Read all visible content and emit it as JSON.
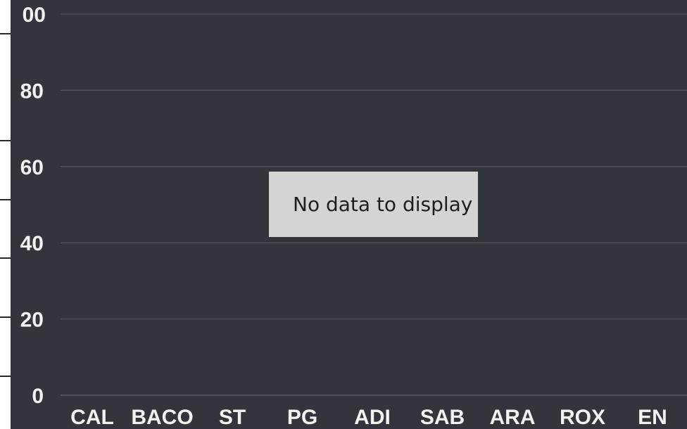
{
  "chart_data": {
    "type": "bar",
    "categories": [
      "CAL",
      "BACO",
      "ST",
      "PG",
      "ADI",
      "SAB",
      "ARA",
      "ROX",
      "EN"
    ],
    "series": [],
    "yticks": [
      "00",
      "80",
      "60",
      "40",
      "20",
      "0"
    ],
    "ylim": [
      0,
      100
    ],
    "grid": true,
    "title": "",
    "xlabel": "",
    "ylabel": ""
  },
  "empty_message": "No data to display",
  "colors": {
    "background": "#33353d",
    "gridline": "#5a5c63",
    "axis_text": "#f2f2f2",
    "message_box": "#d4d4d4",
    "message_text": "#1e1e1e"
  }
}
